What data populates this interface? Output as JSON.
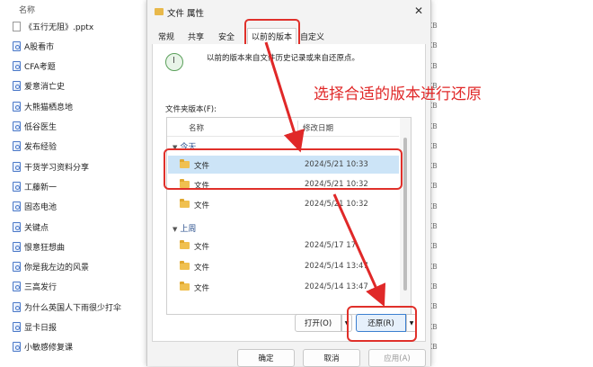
{
  "explorer": {
    "column_name": "名称",
    "files": [
      {
        "name": "《五行无阻》.pptx",
        "icon": "pptx-file-icon",
        "size": "KB"
      },
      {
        "name": "A股看市",
        "icon": "doc-file-icon",
        "size": "KB"
      },
      {
        "name": "CFA考题",
        "icon": "doc-file-icon",
        "size": "KB"
      },
      {
        "name": "爱意消亡史",
        "icon": "doc-file-icon",
        "size": "KB"
      },
      {
        "name": "大熊猫栖息地",
        "icon": "doc-file-icon",
        "size": "KB"
      },
      {
        "name": "低谷医生",
        "icon": "doc-file-icon",
        "size": "KB"
      },
      {
        "name": "发布经验",
        "icon": "doc-file-icon",
        "size": "KB"
      },
      {
        "name": "干货学习资料分享",
        "icon": "doc-file-icon",
        "size": "KB"
      },
      {
        "name": "工藤新一",
        "icon": "doc-file-icon",
        "size": "KB"
      },
      {
        "name": "固态电池",
        "icon": "doc-file-icon",
        "size": "KB"
      },
      {
        "name": "关键点",
        "icon": "doc-file-icon",
        "size": "KB"
      },
      {
        "name": "恨意狂想曲",
        "icon": "doc-file-icon",
        "size": "KB"
      },
      {
        "name": "你是我左边的风景",
        "icon": "doc-file-icon",
        "size": "KB"
      },
      {
        "name": "三高发行",
        "icon": "doc-file-icon",
        "size": "KB"
      },
      {
        "name": "为什么英国人下雨很少打伞",
        "icon": "doc-file-icon",
        "size": "KB"
      },
      {
        "name": "显卡日报",
        "icon": "doc-file-icon",
        "size": "KB"
      },
      {
        "name": "小敏感修复课",
        "icon": "doc-file-icon",
        "size": "KB"
      }
    ]
  },
  "dialog": {
    "title": "文件 属性",
    "tabs": [
      "常规",
      "共享",
      "安全",
      "以前的版本",
      "自定义"
    ],
    "active_tab": "以前的版本",
    "description": "以前的版本来自文件历史记录或来自还原点。",
    "list_label": "文件夹版本(F):",
    "list_headers": {
      "name": "名称",
      "date": "修改日期"
    },
    "groups": [
      {
        "label": "今天",
        "items": [
          {
            "name": "文件",
            "date": "2024/5/21 10:33",
            "selected": true
          },
          {
            "name": "文件",
            "date": "2024/5/21 10:32",
            "selected": false
          },
          {
            "name": "文件",
            "date": "2024/5/21 10:32",
            "selected": false
          }
        ]
      },
      {
        "label": "上周",
        "items": [
          {
            "name": "文件",
            "date": "2024/5/17 17:",
            "selected": false
          },
          {
            "name": "文件",
            "date": "2024/5/14 13:47",
            "selected": false
          },
          {
            "name": "文件",
            "date": "2024/5/14 13:47",
            "selected": false
          }
        ]
      }
    ],
    "buttons": {
      "open": "打开(O)",
      "restore": "还原(R)",
      "ok": "确定",
      "cancel": "取消",
      "apply": "应用(A)"
    }
  },
  "annotation_text": "选择合适的版本进行还原",
  "colors": {
    "annotation": "#e02828",
    "selection": "#cce4f7",
    "folder": "#f0c050"
  }
}
